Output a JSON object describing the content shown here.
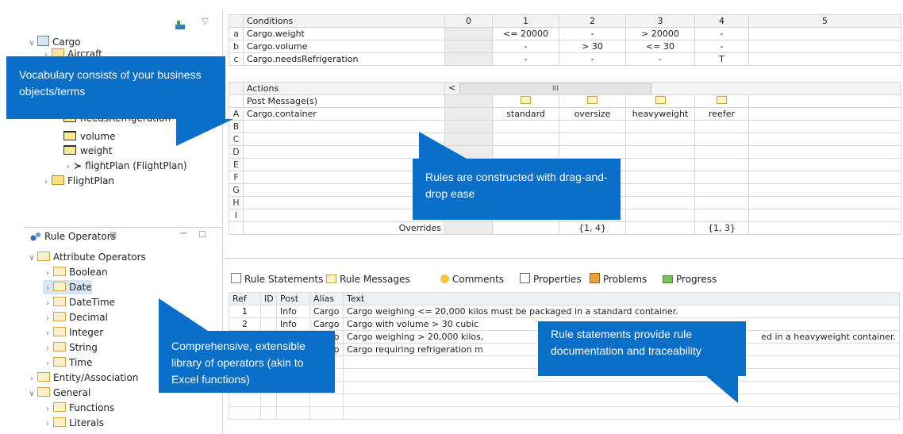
{
  "vocabulary": {
    "root": "Cargo",
    "partial_item": "Aircraft",
    "hidden_item": "needsRefrigeration",
    "items": [
      "volume",
      "weight"
    ],
    "flight_plan_assoc": "flightPlan (FlightPlan)",
    "flight_plan_entity": "FlightPlan"
  },
  "operators": {
    "title": "Rule Operators",
    "tab_close": "⊠",
    "minimize": "−",
    "maximize": "☐",
    "tree": [
      {
        "label": "Attribute Operators",
        "level": 0,
        "expanded": true
      },
      {
        "label": "Boolean",
        "level": 1,
        "expanded": false
      },
      {
        "label": "Date",
        "level": 1,
        "expanded": false,
        "selected": true
      },
      {
        "label": "DateTime",
        "level": 1,
        "expanded": false
      },
      {
        "label": "Decimal",
        "level": 1,
        "expanded": false
      },
      {
        "label": "Integer",
        "level": 1,
        "expanded": false
      },
      {
        "label": "String",
        "level": 1,
        "expanded": false
      },
      {
        "label": "Time",
        "level": 1,
        "expanded": false
      },
      {
        "label": "Entity/Association",
        "level": 0,
        "expanded": false
      },
      {
        "label": "General",
        "level": 0,
        "expanded": true
      },
      {
        "label": "Functions",
        "level": 1,
        "expanded": false
      },
      {
        "label": "Literals",
        "level": 1,
        "expanded": false
      }
    ]
  },
  "rulesheet": {
    "conditions_header": "Conditions",
    "columns": [
      "0",
      "1",
      "2",
      "3",
      "4",
      "5"
    ],
    "conditions": [
      {
        "row": "a",
        "expr": "Cargo.weight",
        "cells": [
          "",
          "<= 20000",
          "-",
          "> 20000",
          "-",
          ""
        ]
      },
      {
        "row": "b",
        "expr": "Cargo.volume",
        "cells": [
          "",
          "-",
          "> 30",
          "<= 30",
          "-",
          ""
        ]
      },
      {
        "row": "c",
        "expr": "Cargo.needsRefrigeration",
        "cells": [
          "",
          "-",
          "-",
          "-",
          "T",
          ""
        ]
      }
    ],
    "actions_header": "Actions",
    "scroll_left": "<",
    "scroll_thumb": "III",
    "post_message": "Post Message(s)",
    "actions": [
      {
        "row": "A",
        "expr": "Cargo.container",
        "cells": [
          "",
          "standard",
          "oversize",
          "heavyweight",
          "reefer",
          ""
        ]
      }
    ],
    "empty_rows": [
      "B",
      "C",
      "D",
      "E",
      "F",
      "G",
      "H",
      "I"
    ],
    "overrides_label": "Overrides",
    "overrides": [
      "",
      "{1, 4}",
      "",
      "{1, 3}",
      ""
    ]
  },
  "bottom_tabs": [
    {
      "label": "Rule Statements",
      "close": "⊠",
      "icon": "rule-statements-icon"
    },
    {
      "label": "Rule Messages",
      "icon": "envelope-icon"
    },
    {
      "label": "Comments",
      "icon": "comments-icon"
    },
    {
      "label": "Properties",
      "icon": "properties-icon"
    },
    {
      "label": "Problems",
      "icon": "problems-icon"
    },
    {
      "label": "Progress",
      "icon": "progress-icon"
    }
  ],
  "statements": {
    "headers": [
      "Ref",
      "ID",
      "Post",
      "Alias",
      "Text"
    ],
    "rows": [
      {
        "ref": "1",
        "id": "",
        "post": "Info",
        "alias": "Cargo",
        "text": "Cargo weighing <= 20,000 kilos must be packaged in a standard container."
      },
      {
        "ref": "2",
        "id": "",
        "post": "Info",
        "alias": "Cargo",
        "text": "Cargo with volume > 30 cubic"
      },
      {
        "ref": "3",
        "id": "",
        "post": "Info",
        "alias": "Cargo",
        "text": "Cargo weighing > 20,000 kilos,",
        "tail": "ed in a heavyweight container."
      },
      {
        "ref": "4",
        "id": "",
        "post": "Info",
        "alias": "Cargo",
        "text": "Cargo requiring refrigeration m"
      }
    ]
  },
  "callouts": {
    "vocabulary": "Vocabulary consists of your business objects/terms",
    "rules": "Rules are constructed with drag-and-drop ease",
    "operators": "Comprehensive, extensible library of operators (akin to Excel functions)",
    "statements": "Rule statements provide rule documentation and traceability"
  },
  "colors": {
    "callout": "#0a6fc9",
    "highlight": "#c9c1e9",
    "selection": "#d6e6f7"
  }
}
